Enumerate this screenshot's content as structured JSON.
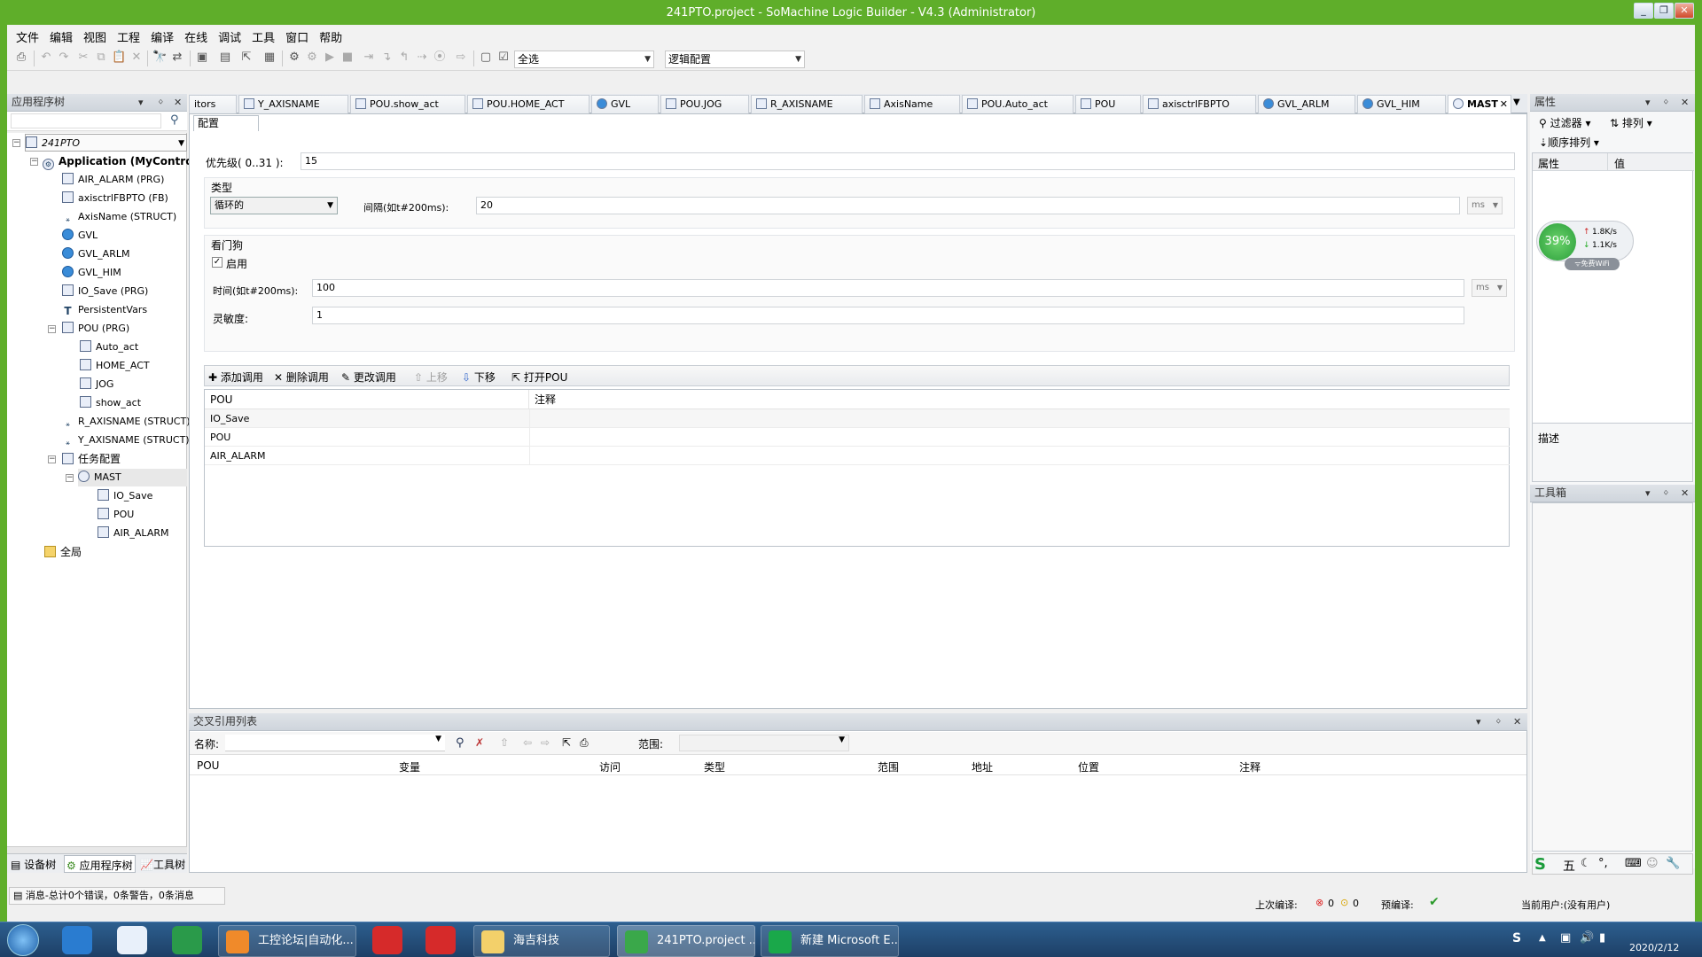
{
  "window": {
    "title": "241PTO.project - SoMachine Logic Builder - V4.3 (Administrator)"
  },
  "menu": [
    "文件",
    "编辑",
    "视图",
    "工程",
    "编译",
    "在线",
    "调试",
    "工具",
    "窗口",
    "帮助"
  ],
  "toolbar": {
    "select_combo": "全选",
    "config_combo": "逻辑配置"
  },
  "left_panel": {
    "title": "应用程序树",
    "bottom_tabs": [
      "设备树",
      "应用程序树",
      "工具树"
    ]
  },
  "tree": {
    "root": "241PTO",
    "app": "Application (MyControlle",
    "items": [
      "AIR_ALARM (PRG)",
      "axisctrlFBPTO (FB)",
      "AxisName (STRUCT)",
      "GVL",
      "GVL_ARLM",
      "GVL_HIM",
      "IO_Save (PRG)",
      "PersistentVars",
      "POU (PRG)"
    ],
    "pou_children": [
      "Auto_act",
      "HOME_ACT",
      "JOG",
      "show_act"
    ],
    "items2": [
      "R_AXISNAME (STRUCT)",
      "Y_AXISNAME (STRUCT)",
      "任务配置"
    ],
    "mast": "MAST",
    "mast_children": [
      "IO_Save",
      "POU",
      "AIR_ALARM"
    ],
    "global": "全局"
  },
  "tabs": [
    "itors",
    "Y_AXISNAME",
    "POU.show_act",
    "POU.HOME_ACT",
    "GVL",
    "POU.JOG",
    "R_AXISNAME",
    "AxisName",
    "POU.Auto_act",
    "POU",
    "axisctrlFBPTO",
    "GVL_ARLM",
    "GVL_HIM",
    "MAST"
  ],
  "editor": {
    "subtab": "配置",
    "priority_label": "优先级( 0..31 ):",
    "priority_value": "15",
    "type_group": "类型",
    "type_value": "循环的",
    "interval_label": "间隔(如t#200ms):",
    "interval_value": "20",
    "interval_unit": "ms",
    "watchdog_group": "看门狗",
    "enable_label": "启用",
    "time_label": "时间(如t#200ms):",
    "time_value": "100",
    "time_unit": "ms",
    "sensitivity_label": "灵敏度:",
    "sensitivity_value": "1",
    "actions": {
      "add": "添加调用",
      "delete": "删除调用",
      "change": "更改调用",
      "up": "上移",
      "down": "下移",
      "open": "打开POU"
    },
    "table": {
      "headers": [
        "POU",
        "注释"
      ],
      "rows": [
        "IO_Save",
        "POU",
        "AIR_ALARM"
      ]
    }
  },
  "properties": {
    "title": "属性",
    "filter": "过滤器",
    "sort": "排列",
    "order": "顺序排列",
    "col_prop": "属性",
    "col_val": "值",
    "desc": "描述",
    "toolbox": "工具箱"
  },
  "net_widget": {
    "percent": "39%",
    "up": "1.8K/s",
    "down": "1.1K/s",
    "wifi": "免费WiFi"
  },
  "xref": {
    "title": "交叉引用列表",
    "name_label": "名称:",
    "scope_label": "范围:",
    "headers": [
      "POU",
      "变量",
      "访问",
      "类型",
      "范围",
      "地址",
      "位置",
      "注释"
    ]
  },
  "status": {
    "messages": "消息-总计0个错误，0条警告，0条消息",
    "last_compile": "上次编译:",
    "err": "0",
    "warn": "0",
    "precompile": "预编译:",
    "current_user": "当前用户:(没有用户)"
  },
  "ime": [
    "五"
  ],
  "taskbar": {
    "items": [
      "工控论坛|自动化...",
      "海吉科技",
      "241PTO.project ...",
      "新建 Microsoft E..."
    ],
    "date": "2020/2/12"
  }
}
